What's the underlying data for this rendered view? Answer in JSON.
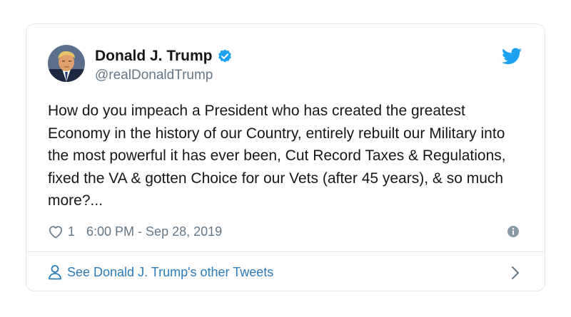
{
  "tweet": {
    "display_name": "Donald J. Trump",
    "handle": "@realDonaldTrump",
    "verified": true,
    "text": "How do you impeach a President who has created the greatest Economy in the history of our Country, entirely rebuilt our Military into the most powerful it has ever been, Cut Record Taxes & Regulations, fixed the VA & gotten Choice for our Vets (after 45 years), & so much more?...",
    "like_count": "1",
    "timestamp": "6:00 PM - Sep 28, 2019"
  },
  "footer": {
    "link_label": "See Donald J. Trump's other Tweets"
  },
  "icons": {
    "logo": "twitter-bird-icon",
    "verified": "verified-badge-icon",
    "like": "heart-icon",
    "info": "info-icon",
    "person": "person-icon",
    "chevron": "chevron-right-icon"
  },
  "colors": {
    "accent": "#1da1f2",
    "link": "#2b7bb9",
    "secondary_text": "#657786",
    "border": "#e1e8ed"
  }
}
